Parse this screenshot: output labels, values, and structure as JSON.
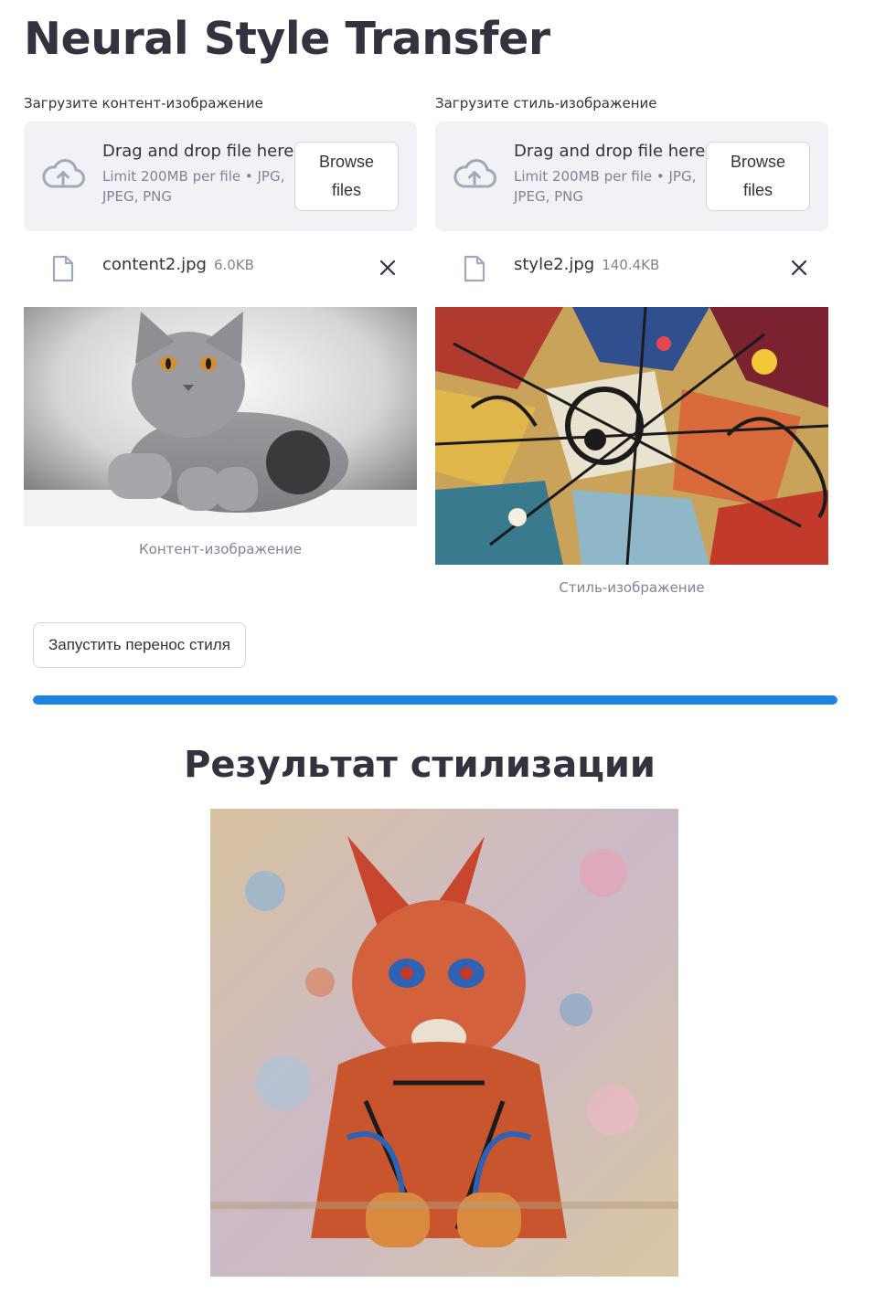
{
  "app": {
    "title": "Neural Style Transfer"
  },
  "content_uploader": {
    "label": "Загрузите контент-изображение",
    "drop_title": "Drag and drop file here",
    "limit_text": "Limit 200MB per file • JPG, JPEG, PNG",
    "browse_label": "Browse files",
    "file_name": "content2.jpg",
    "file_size": "6.0KB",
    "image_caption": "Контент-изображение"
  },
  "style_uploader": {
    "label": "Загрузите стиль-изображение",
    "drop_title": "Drag and drop file here",
    "limit_text": "Limit 200MB per file • JPG, JPEG, PNG",
    "browse_label": "Browse files",
    "file_name": "style2.jpg",
    "file_size": "140.4KB",
    "image_caption": "Стиль-изображение"
  },
  "actions": {
    "run_label": "Запустить перенос стиля"
  },
  "progress": {
    "value_percent": 100
  },
  "result": {
    "title": "Результат стилизации"
  },
  "colors": {
    "accent": "#1c83e1",
    "text": "#31333f",
    "muted": "#808495",
    "dropzone_bg": "#f0f2f6"
  },
  "icons": {
    "upload": "cloud-upload-icon",
    "file": "file-icon",
    "remove": "close-icon"
  }
}
